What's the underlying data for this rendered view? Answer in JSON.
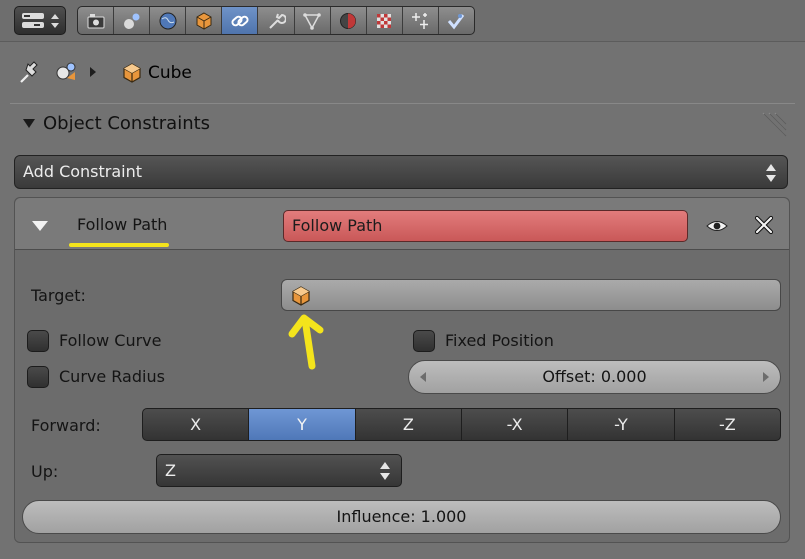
{
  "tabs": [
    {
      "icon": "render-icon",
      "active": false
    },
    {
      "icon": "render-layers-icon",
      "active": false
    },
    {
      "icon": "world-icon",
      "active": false
    },
    {
      "icon": "object-icon",
      "active": false
    },
    {
      "icon": "constraints-icon",
      "active": true
    },
    {
      "icon": "modifiers-icon",
      "active": false
    },
    {
      "icon": "data-icon",
      "active": false
    },
    {
      "icon": "material-icon",
      "active": false
    },
    {
      "icon": "texture-icon",
      "active": false
    },
    {
      "icon": "particles-icon",
      "active": false
    },
    {
      "icon": "physics-icon",
      "active": false
    }
  ],
  "breadcrumb": {
    "object_name": "Cube"
  },
  "panel": {
    "title": "Object Constraints"
  },
  "add_constraint": {
    "label": "Add Constraint"
  },
  "constraint": {
    "type_label": "Follow Path",
    "name": "Follow Path",
    "target_label": "Target:",
    "follow_curve_label": "Follow Curve",
    "curve_radius_label": "Curve Radius",
    "fixed_position_label": "Fixed Position",
    "follow_curve_checked": false,
    "curve_radius_checked": false,
    "fixed_position_checked": false,
    "offset_text": "Offset: 0.000",
    "forward_label": "Forward:",
    "forward_axes": [
      "X",
      "Y",
      "Z",
      "-X",
      "-Y",
      "-Z"
    ],
    "forward_selected": "Y",
    "up_label": "Up:",
    "up_value": "Z",
    "influence_text": "Influence: 1.000"
  },
  "colors": {
    "background": "#727272",
    "active_tab": "#5a7fbc",
    "name_field": "#d86a6a",
    "annotation": "#f4e41c"
  }
}
